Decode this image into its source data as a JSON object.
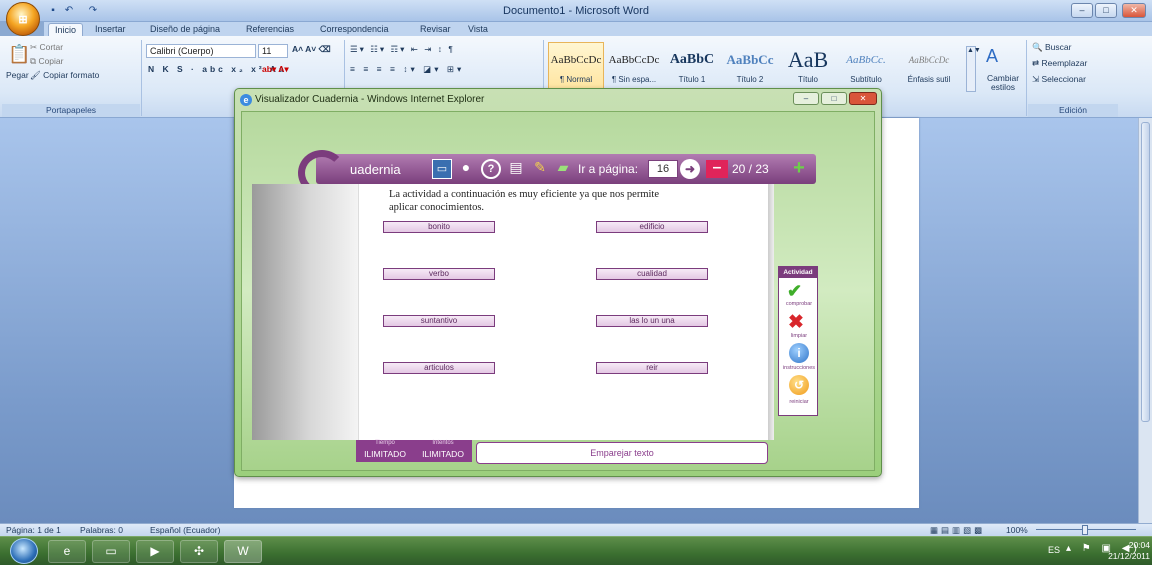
{
  "word": {
    "title": "Documento1 - Microsoft Word",
    "tabs": [
      "Inicio",
      "Insertar",
      "Diseño de página",
      "Referencias",
      "Correspondencia",
      "Revisar",
      "Vista"
    ],
    "clipboard": {
      "paste": "Pegar",
      "cut": "Cortar",
      "copy": "Copiar",
      "format": "Copiar formato",
      "label": "Portapapeles"
    },
    "font": {
      "name": "Calibri (Cuerpo)",
      "size": "11"
    },
    "styles": [
      {
        "preview": "AaBbCcDc",
        "name": "¶ Normal"
      },
      {
        "preview": "AaBbCcDc",
        "name": "¶ Sin espa..."
      },
      {
        "preview": "AaBbC",
        "name": "Título 1"
      },
      {
        "preview": "AaBbCc",
        "name": "Título 2"
      },
      {
        "preview": "AaB",
        "name": "Título"
      },
      {
        "preview": "AaBbCc.",
        "name": "Subtítulo"
      },
      {
        "preview": "AaBbCcDc",
        "name": "Énfasis sutil"
      }
    ],
    "change_styles": "Cambiar estilos",
    "editing": {
      "find": "Buscar",
      "replace": "Reemplazar",
      "select": "Seleccionar",
      "label": "Edición"
    },
    "status": {
      "page": "Página: 1 de 1",
      "words": "Palabras: 0",
      "lang": "Español (Ecuador)",
      "zoom": "100%"
    }
  },
  "ie": {
    "title": "Visualizador Cuadernia - Windows Internet Explorer"
  },
  "cuadernia": {
    "logo": "uadernia",
    "goto_label": "Ir a página:",
    "page_input": "16",
    "page_count": "20 / 23",
    "instruction": "La actividad a continuación  es muy eficiente ya que nos permite aplicar conocimientos.",
    "left_words": [
      "bonito",
      "verbo",
      "suntantivo",
      "articulos"
    ],
    "right_words": [
      "edificio",
      "cualidad",
      "las lo un una",
      "reir"
    ],
    "activity": {
      "header": "Actividad",
      "check": "comprobar",
      "clear": "limpiar",
      "info": "instrucciones",
      "reset": "reiniciar"
    },
    "footer": {
      "time_label": "Tiempo",
      "time_value": "ILIMITADO",
      "tries_label": "Intentos",
      "tries_value": "ILIMITADO",
      "activity_name": "Emparejar texto"
    }
  },
  "taskbar": {
    "lang": "ES",
    "time": "20:04",
    "date": "21/12/2011"
  }
}
